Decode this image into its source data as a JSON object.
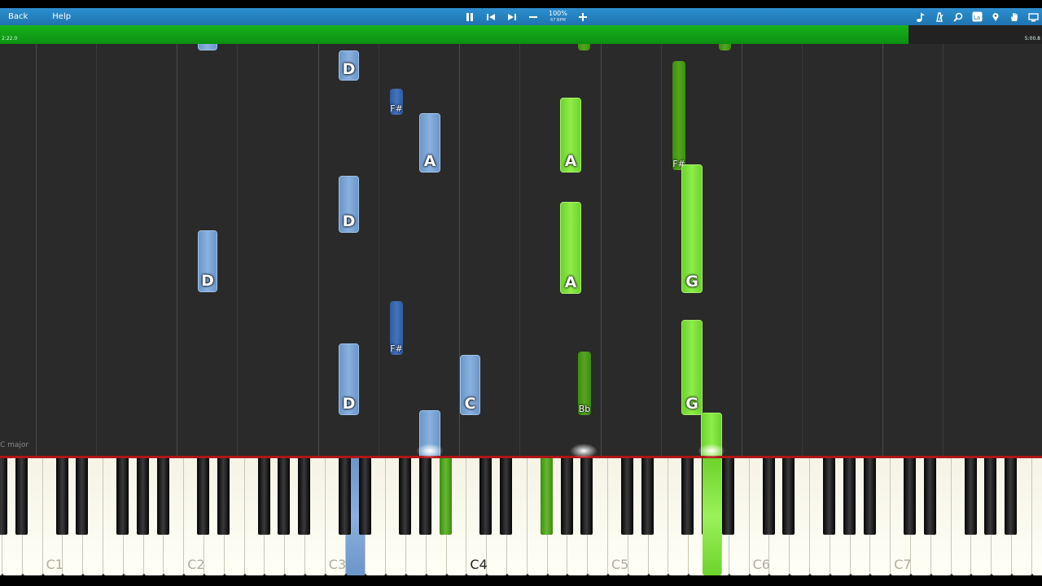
{
  "toolbar": {
    "back_label": "Back",
    "help_label": "Help",
    "zoom_text": "100%",
    "bpm_text": "67 BPM",
    "colors": {
      "bar": "#2388c8",
      "progress": "#13a818"
    }
  },
  "progress": {
    "elapsed": "2:22.0",
    "total": "5:00.8",
    "fraction": 0.872
  },
  "key_signature": "C major",
  "notes": {
    "n1": "D",
    "n2": "D",
    "n3": "D",
    "n4": "D",
    "n5": "D",
    "n6": "F#",
    "n7": "F#",
    "n8": "A",
    "n9": "C",
    "n10": "A",
    "n11": "A",
    "n12": "F#",
    "n13": "G",
    "n14": "G",
    "n15": "Bb",
    "n16": "Bb",
    "n17": "Bb"
  },
  "octave_labels": [
    "C1",
    "C2",
    "C3",
    "C4",
    "C5",
    "C6",
    "C7",
    "C8"
  ]
}
